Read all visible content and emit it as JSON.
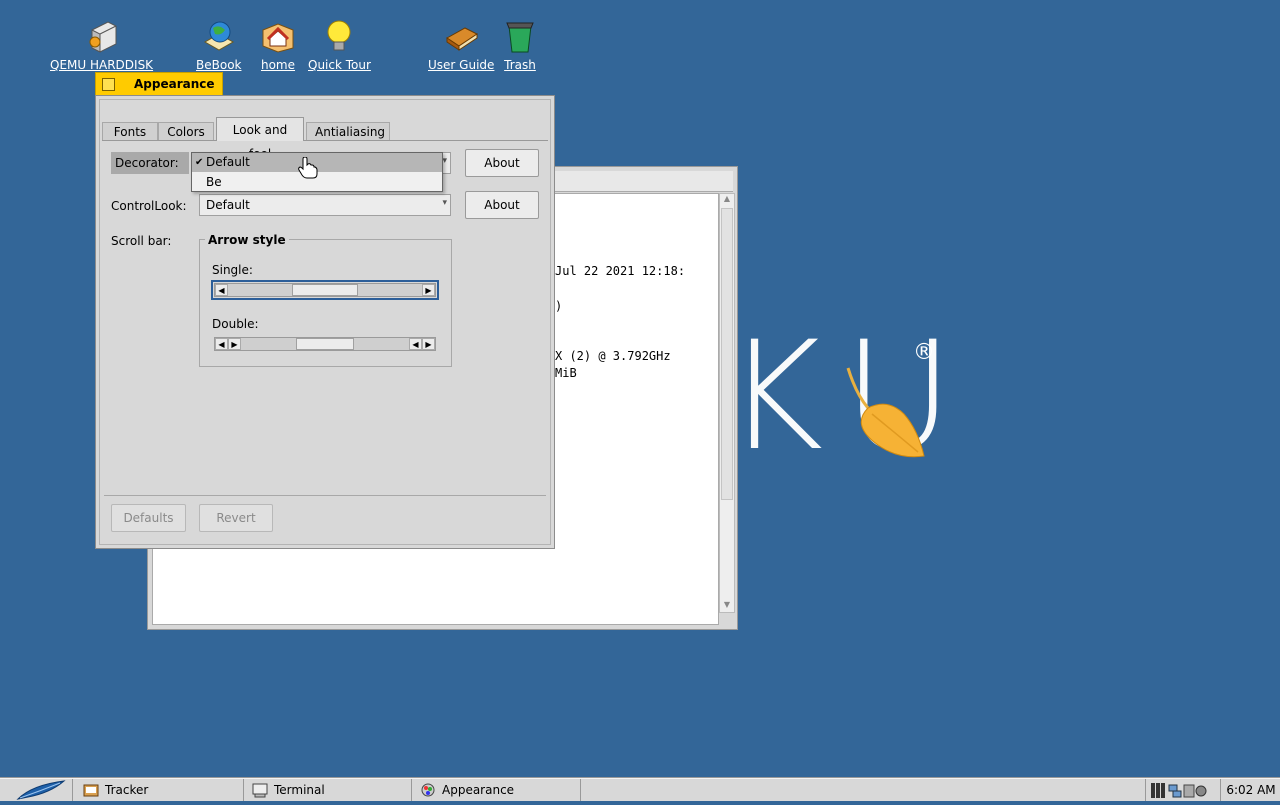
{
  "desktop": {
    "icons": [
      {
        "label": "QEMU HARDDISK",
        "icon": "harddisk-icon"
      },
      {
        "label": "BeBook",
        "icon": "bebook-icon"
      },
      {
        "label": "home",
        "icon": "home-folder-icon"
      },
      {
        "label": "Quick Tour",
        "icon": "lightbulb-icon"
      },
      {
        "label": "User Guide",
        "icon": "book-icon"
      },
      {
        "label": "Trash",
        "icon": "trash-icon"
      }
    ],
    "logo_reg": "®",
    "logo_text": "KU"
  },
  "background_window": {
    "lines": [
      "Jul 22 2021 12:18:",
      ")",
      "X (2) @ 3.792GHz",
      "MiB"
    ]
  },
  "appearance": {
    "title": "Appearance",
    "tabs": [
      "Fonts",
      "Colors",
      "Look and feel",
      "Antialiasing"
    ],
    "active_tab": "Look and feel",
    "decorator": {
      "label": "Decorator:",
      "value": "Default",
      "options": [
        "Default",
        "Be"
      ],
      "about": "About"
    },
    "control_look": {
      "label": "ControlLook:",
      "value": "Default",
      "about": "About"
    },
    "scroll_bar": {
      "label": "Scroll bar:",
      "group_title": "Arrow style",
      "single_label": "Single:",
      "double_label": "Double:"
    },
    "defaults_button": "Defaults",
    "revert_button": "Revert"
  },
  "taskbar": {
    "items": [
      {
        "label": "Tracker",
        "icon": "tracker-icon"
      },
      {
        "label": "Terminal",
        "icon": "terminal-icon"
      },
      {
        "label": "Appearance",
        "icon": "appearance-icon"
      }
    ],
    "clock": "6:02 AM"
  }
}
